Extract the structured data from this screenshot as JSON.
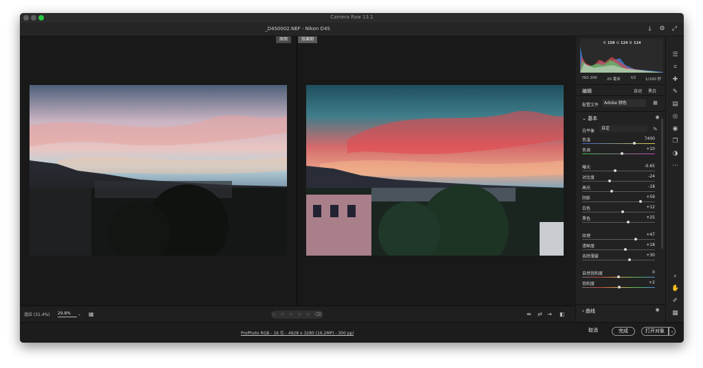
{
  "window": {
    "title": "Camera Raw 13.1",
    "filename": "_D4S0002.NEF  -  Nikon D4S"
  },
  "view": {
    "before_label": "原图",
    "after_label": "效果图"
  },
  "bottombar": {
    "fit_label": "适应 (31.4%)",
    "zoom_value": "29.8%",
    "stars": "☆ ☆ ☆ ☆ ☆  ⌫"
  },
  "footer": {
    "profile_link": "ProPhoto RGB - 16 位 - 4928 x 3280 (16.2MP) - 300 ppi",
    "cancel_label": "取消",
    "done_label": "完成",
    "open_label": "打开对象"
  },
  "histogram": {
    "r_label": "R",
    "r_value": "158",
    "g_label": "G",
    "g_value": "124",
    "b_label": "B",
    "b_value": "114"
  },
  "exif": {
    "iso": "ISO 200",
    "focal": "20 毫米",
    "aperture": "f/2",
    "shutter": "1/100 秒"
  },
  "edit": {
    "title": "编辑",
    "auto_label": "自动",
    "bw_label": "黑白"
  },
  "profile": {
    "label": "配置文件",
    "value": "Adobe 颜色"
  },
  "basic": {
    "title": "基本",
    "wb_label": "白平衡",
    "wb_value": "自定",
    "sliders": [
      {
        "label": "色温",
        "value": "7400",
        "pos": 0.72
      },
      {
        "label": "色调",
        "value": "+10",
        "pos": 0.55
      },
      {
        "label": "曝光",
        "value": "-0.65",
        "pos": 0.45
      },
      {
        "label": "对比度",
        "value": "-24",
        "pos": 0.38
      },
      {
        "label": "高光",
        "value": "-18",
        "pos": 0.41
      },
      {
        "label": "阴影",
        "value": "+59",
        "pos": 0.8
      },
      {
        "label": "白色",
        "value": "+12",
        "pos": 0.56
      },
      {
        "label": "黑色",
        "value": "+25",
        "pos": 0.63
      },
      {
        "label": "纹理",
        "value": "+47",
        "pos": 0.74
      },
      {
        "label": "清晰度",
        "value": "+18",
        "pos": 0.59
      },
      {
        "label": "去除薄雾",
        "value": "+30",
        "pos": 0.65
      },
      {
        "label": "自然饱和度",
        "value": "0",
        "pos": 0.5
      },
      {
        "label": "饱和度",
        "value": "+2",
        "pos": 0.51
      }
    ]
  },
  "curve": {
    "title": "曲线"
  },
  "colors": {
    "accent": "#ffffff",
    "panel": "#222222",
    "window": "#1e1e1e"
  }
}
